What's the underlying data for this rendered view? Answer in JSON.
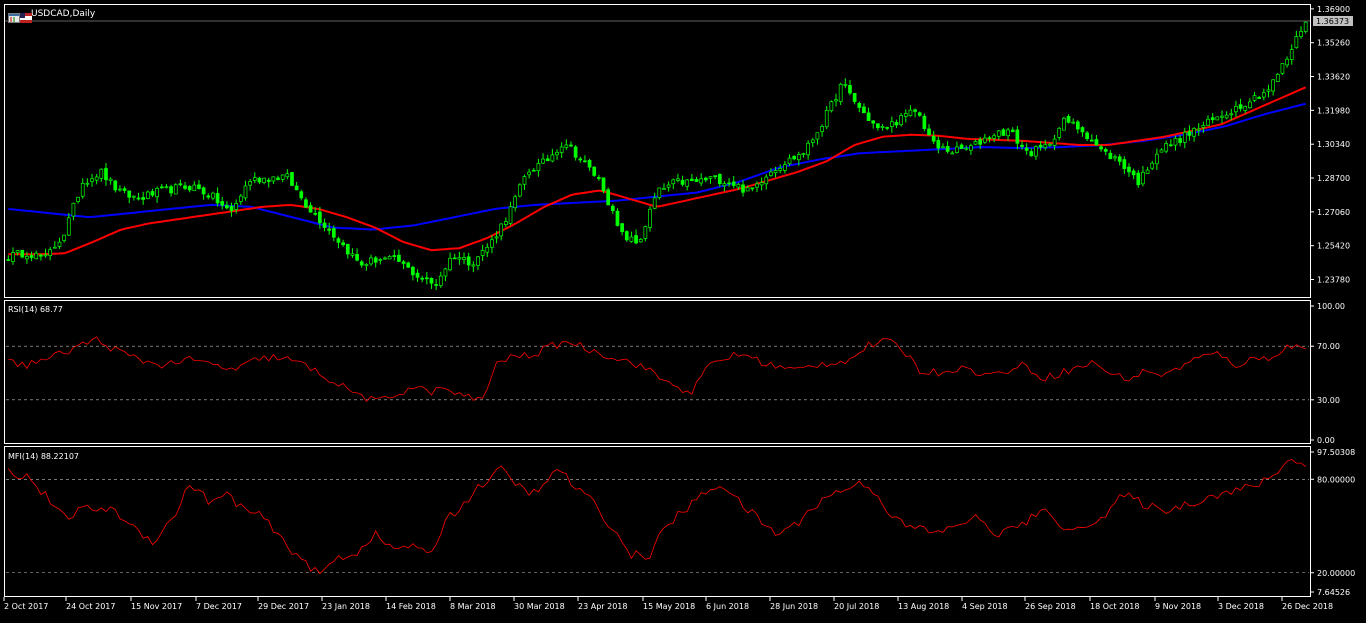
{
  "header": {
    "title": "USDCAD,Daily",
    "current_price_label": "1.36373"
  },
  "indicators": {
    "rsi_label": "RSI(14) 68.77",
    "mfi_label": "MFI(14) 88.22107"
  },
  "colors": {
    "background": "#000000",
    "candle_bull": "#00ff00",
    "candle_bear": "#00ff00",
    "ma_fast": "#ff0000",
    "ma_slow": "#0000ff",
    "osc_line": "#ff0000",
    "grid_dashed": "#c0c0c0",
    "axis": "#ffffff"
  },
  "chart_data": [
    {
      "type": "candlestick",
      "panel": "main",
      "title": "USDCAD,Daily",
      "ylim": [
        1.2298,
        1.3704
      ],
      "y_ticks": [
        "1.36900",
        "1.35260",
        "1.33620",
        "1.31980",
        "1.30340",
        "1.28700",
        "1.27060",
        "1.25420",
        "1.23780"
      ],
      "x_ticks": [
        "2 Oct 2017",
        "24 Oct 2017",
        "15 Nov 2017",
        "7 Dec 2017",
        "29 Dec 2017",
        "23 Jan 2018",
        "14 Feb 2018",
        "8 Mar 2018",
        "30 Mar 2018",
        "23 Apr 2018",
        "15 May 2018",
        "6 Jun 2018",
        "28 Jun 2018",
        "20 Jul 2018",
        "13 Aug 2018",
        "4 Sep 2018",
        "26 Sep 2018",
        "18 Oct 2018",
        "9 Nov 2018",
        "3 Dec 2018",
        "26 Dec 2018"
      ],
      "close_anchors": [
        1.249,
        1.251,
        1.248,
        1.26,
        1.285,
        1.29,
        1.28,
        1.277,
        1.28,
        1.282,
        1.283,
        1.278,
        1.27,
        1.286,
        1.287,
        1.288,
        1.275,
        1.265,
        1.255,
        1.245,
        1.248,
        1.247,
        1.24,
        1.235,
        1.25,
        1.246,
        1.255,
        1.27,
        1.29,
        1.295,
        1.305,
        1.295,
        1.285,
        1.26,
        1.255,
        1.28,
        1.285,
        1.285,
        1.287,
        1.285,
        1.28,
        1.29,
        1.295,
        1.3,
        1.315,
        1.333,
        1.32,
        1.31,
        1.315,
        1.32,
        1.302,
        1.3,
        1.302,
        1.308,
        1.31,
        1.299,
        1.302,
        1.315,
        1.31,
        1.3,
        1.295,
        1.285,
        1.3,
        1.305,
        1.31,
        1.315,
        1.32,
        1.325,
        1.33,
        1.345,
        1.3637
      ],
      "ma_fast_anchors": [
        1.25,
        1.25,
        1.2505,
        1.256,
        1.262,
        1.265,
        1.267,
        1.269,
        1.271,
        1.273,
        1.274,
        1.272,
        1.268,
        1.263,
        1.256,
        1.252,
        1.253,
        1.258,
        1.265,
        1.273,
        1.279,
        1.281,
        1.277,
        1.273,
        1.276,
        1.279,
        1.282,
        1.286,
        1.29,
        1.295,
        1.303,
        1.307,
        1.308,
        1.3075,
        1.306,
        1.3055,
        1.305,
        1.304,
        1.303,
        1.303,
        1.305,
        1.307,
        1.31,
        1.313,
        1.319,
        1.325,
        1.331
      ],
      "ma_slow_anchors": [
        1.272,
        1.27,
        1.268,
        1.27,
        1.272,
        1.274,
        1.273,
        1.268,
        1.263,
        1.262,
        1.264,
        1.268,
        1.272,
        1.274,
        1.275,
        1.276,
        1.278,
        1.28,
        1.285,
        1.292,
        1.296,
        1.299,
        1.3,
        1.301,
        1.302,
        1.3015,
        1.302,
        1.303,
        1.305,
        1.308,
        1.312,
        1.318,
        1.323
      ]
    },
    {
      "type": "line",
      "panel": "rsi",
      "title": "RSI(14) 68.77",
      "ylim": [
        0,
        100
      ],
      "y_ticks": [
        "100.00",
        "70.00",
        "30.00",
        "0.00"
      ],
      "levels": [
        70,
        30
      ],
      "anchors": [
        58,
        56,
        60,
        64,
        70,
        75,
        68,
        62,
        58,
        56,
        60,
        58,
        55,
        52,
        59,
        62,
        60,
        55,
        48,
        40,
        34,
        28,
        33,
        40,
        36,
        38,
        32,
        30,
        60,
        62,
        64,
        70,
        74,
        68,
        64,
        60,
        56,
        48,
        40,
        36,
        56,
        62,
        64,
        58,
        54,
        52,
        56,
        58,
        60,
        70,
        74,
        68,
        52,
        50,
        54,
        52,
        48,
        52,
        56,
        46,
        50,
        54,
        58,
        48,
        46,
        52,
        48,
        56,
        62,
        64,
        56,
        60,
        62,
        70,
        69
      ]
    },
    {
      "type": "line",
      "panel": "mfi",
      "title": "MFI(14) 88.22107",
      "ylim": [
        7.64526,
        97.50308
      ],
      "y_ticks": [
        "97.50308",
        "80.00000",
        "20.00000",
        "7.64526"
      ],
      "levels": [
        80,
        20
      ],
      "anchors": [
        85,
        82,
        70,
        55,
        60,
        62,
        58,
        48,
        40,
        55,
        78,
        65,
        70,
        60,
        55,
        40,
        30,
        18,
        30,
        32,
        45,
        35,
        38,
        30,
        55,
        65,
        78,
        86,
        75,
        70,
        88,
        75,
        65,
        50,
        32,
        30,
        50,
        60,
        70,
        78,
        65,
        55,
        45,
        50,
        62,
        70,
        75,
        78,
        62,
        50,
        48,
        45,
        52,
        55,
        45,
        48,
        55,
        60,
        45,
        52,
        56,
        70,
        65,
        60,
        62,
        66,
        70,
        72,
        75,
        80,
        92,
        90
      ]
    }
  ]
}
